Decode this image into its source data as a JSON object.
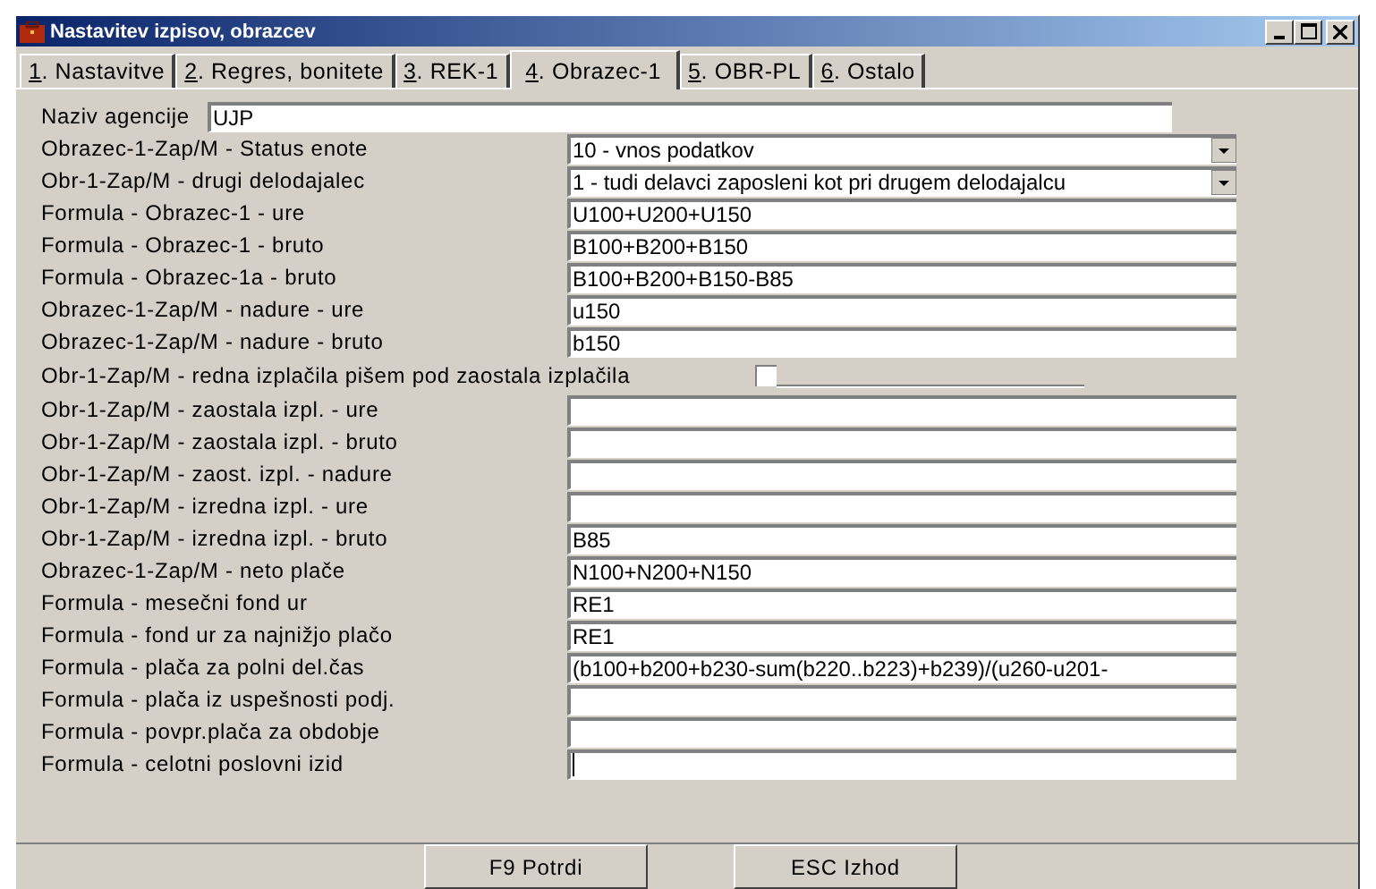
{
  "window": {
    "title": "Nastavitev izpisov, obrazcev"
  },
  "tabs": [
    {
      "label": "1. Nastavitve",
      "selected": false
    },
    {
      "label": "2. Regres, bonitete",
      "selected": false
    },
    {
      "label": "3. REK-1",
      "selected": false
    },
    {
      "label": "4. Obrazec-1",
      "selected": true
    },
    {
      "label": "5. OBR-PL",
      "selected": false
    },
    {
      "label": "6. Ostalo",
      "selected": false
    }
  ],
  "fields": [
    {
      "kind": "wide",
      "label": "Naziv agencije",
      "value": "UJP",
      "focused": false
    },
    {
      "kind": "select",
      "label": "Obrazec-1-Zap/M - Status enote",
      "value": "10 - vnos podatkov",
      "focused": false
    },
    {
      "kind": "select",
      "label": "Obr-1-Zap/M - drugi delodajalec",
      "value": "1 - tudi delavci zaposleni kot pri drugem delodajalcu",
      "focused": false
    },
    {
      "kind": "text",
      "label": "Formula - Obrazec-1 - ure",
      "value": "U100+U200+U150",
      "focused": false
    },
    {
      "kind": "text",
      "label": "Formula - Obrazec-1 - bruto",
      "value": "B100+B200+B150",
      "focused": false
    },
    {
      "kind": "text",
      "label": "Formula - Obrazec-1a - bruto",
      "value": "B100+B200+B150-B85",
      "focused": false
    },
    {
      "kind": "text",
      "label": "Obrazec-1-Zap/M - nadure - ure",
      "value": "u150",
      "focused": false
    },
    {
      "kind": "text",
      "label": "Obrazec-1-Zap/M - nadure - bruto",
      "value": "b150",
      "focused": false
    },
    {
      "kind": "checkbox",
      "label": "Obr-1-Zap/M - redna izplačila pišem pod zaostala izplačila",
      "checked": false
    },
    {
      "kind": "text",
      "label": "Obr-1-Zap/M - zaostala izpl. - ure",
      "focused": false
    },
    {
      "kind": "text",
      "label": "Obr-1-Zap/M - zaostala izpl. - bruto",
      "focused": false
    },
    {
      "kind": "text",
      "label": "Obr-1-Zap/M - zaost. izpl. - nadure",
      "focused": false
    },
    {
      "kind": "text",
      "label": "Obr-1-Zap/M - izredna izpl. - ure",
      "focused": false
    },
    {
      "kind": "text",
      "label": "Obr-1-Zap/M - izredna izpl. - bruto",
      "value": "B85",
      "focused": false
    },
    {
      "kind": "text",
      "label": "Obrazec-1-Zap/M - neto plače",
      "value": "N100+N200+N150",
      "focused": false
    },
    {
      "kind": "text",
      "label": "Formula - mesečni fond ur",
      "value": "RE1",
      "focused": false
    },
    {
      "kind": "text",
      "label": "Formula - fond ur za najnižjo plačo",
      "value": "RE1",
      "focused": false
    },
    {
      "kind": "text",
      "label": "Formula - plača za polni del.čas",
      "value": "(b100+b200+b230-sum(b220..b223)+b239)/(u260-u201-",
      "focused": false
    },
    {
      "kind": "text",
      "label": "Formula - plača iz uspešnosti podj.",
      "focused": false
    },
    {
      "kind": "text",
      "label": "Formula - povpr.plača za obdobje",
      "focused": false
    },
    {
      "kind": "text",
      "label": "Formula - celotni poslovni izid",
      "focused": true
    }
  ],
  "buttons": [
    "F9  Potrdi",
    "ESC  Izhod"
  ]
}
